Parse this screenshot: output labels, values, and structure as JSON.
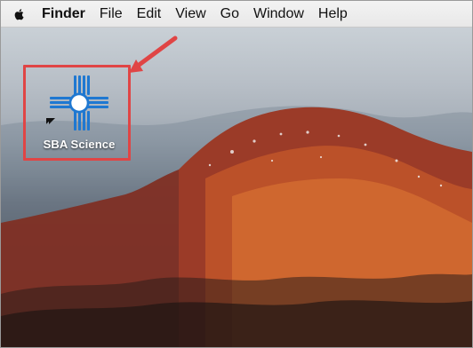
{
  "menubar": {
    "items": [
      "Finder",
      "File",
      "Edit",
      "View",
      "Go",
      "Window",
      "Help"
    ]
  },
  "desktop": {
    "icons": [
      {
        "label": "SBA Science"
      }
    ]
  },
  "colors": {
    "annotation_red": "#e04545",
    "zia_blue": "#1f78d1"
  },
  "icons": {
    "apple": "apple-logo-icon",
    "app": "zia-sun-symbol-icon",
    "alias_arrow": "alias-arrow-icon"
  }
}
